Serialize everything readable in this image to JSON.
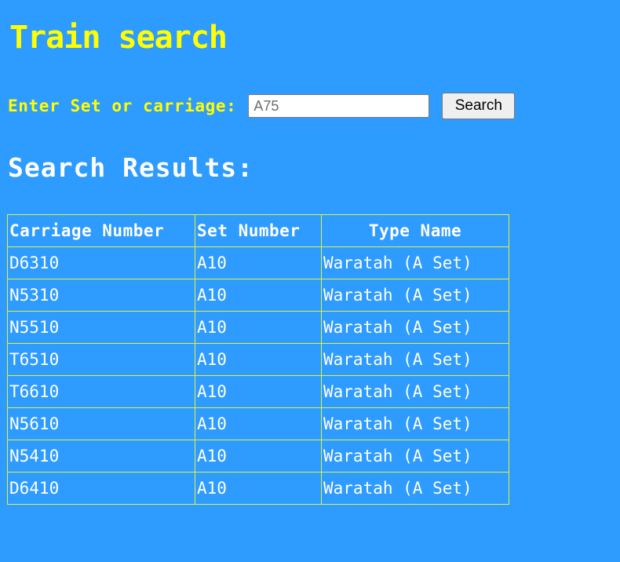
{
  "page": {
    "title": "Train search"
  },
  "search": {
    "label": "Enter Set or carriage:",
    "value": "A75",
    "button_label": "Search"
  },
  "results": {
    "heading": "Search Results:",
    "columns": [
      "Carriage Number",
      "Set Number",
      "Type Name"
    ],
    "rows": [
      {
        "carriage": "D6310",
        "set": "A10",
        "type": "Waratah (A Set)"
      },
      {
        "carriage": "N5310",
        "set": "A10",
        "type": "Waratah (A Set)"
      },
      {
        "carriage": "N5510",
        "set": "A10",
        "type": "Waratah (A Set)"
      },
      {
        "carriage": "T6510",
        "set": "A10",
        "type": "Waratah (A Set)"
      },
      {
        "carriage": "T6610",
        "set": "A10",
        "type": "Waratah (A Set)"
      },
      {
        "carriage": "N5610",
        "set": "A10",
        "type": "Waratah (A Set)"
      },
      {
        "carriage": "N5410",
        "set": "A10",
        "type": "Waratah (A Set)"
      },
      {
        "carriage": "D6410",
        "set": "A10",
        "type": "Waratah (A Set)"
      }
    ]
  },
  "colors": {
    "background": "#2e9bff",
    "accent_yellow": "#ffff00",
    "table_border": "#e2f23a",
    "text_white": "#ffffff"
  }
}
